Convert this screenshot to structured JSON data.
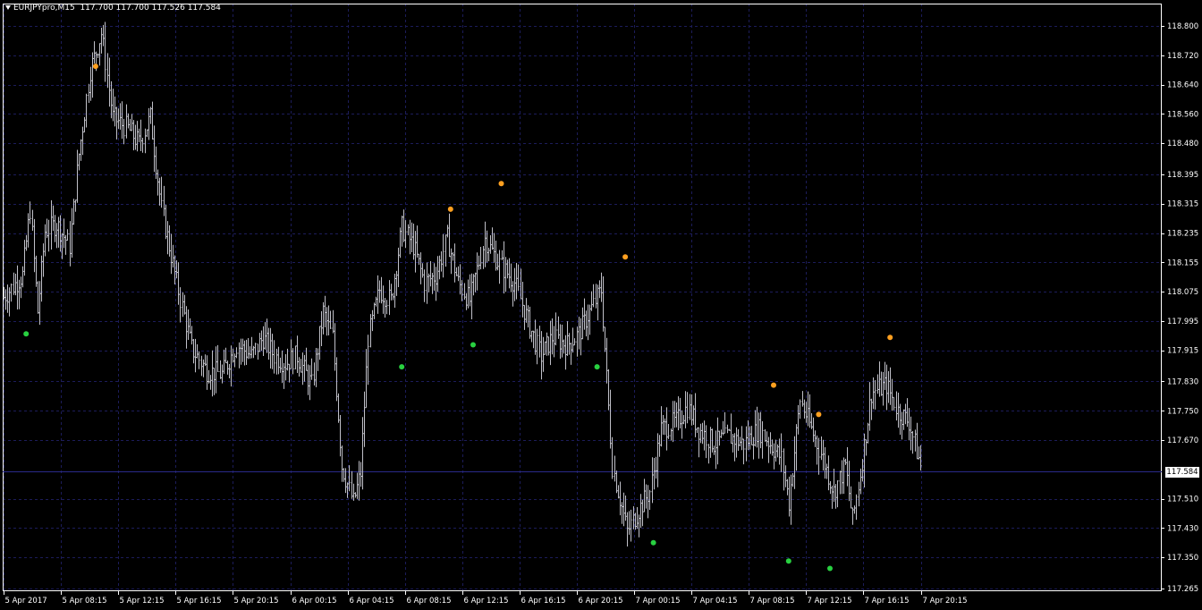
{
  "header": {
    "symbol_timeframe": "EURJPYpro,M15",
    "ohlc": "117.700 117.700 117.526 117.584"
  },
  "current_price": "117.584",
  "colors": {
    "background": "#000000",
    "grid": "#1c1c5a",
    "bars": "#c0c0c8",
    "axis": "#ffffff",
    "resistance_dot": "#ffa020",
    "support_dot": "#28d040",
    "bid_line": "#2a2a8a"
  },
  "chart_data": {
    "type": "ohlc",
    "symbol": "EURJPYpro",
    "timeframe": "M15",
    "ylim": [
      117.26,
      118.86
    ],
    "y_ticks": [
      "118.800",
      "118.720",
      "118.640",
      "118.560",
      "118.480",
      "118.395",
      "118.315",
      "118.235",
      "118.155",
      "118.075",
      "117.995",
      "117.915",
      "117.830",
      "117.750",
      "117.670",
      "117.584",
      "117.510",
      "117.430",
      "117.350",
      "117.265"
    ],
    "x_ticks": [
      "5 Apr 2017",
      "5 Apr 08:15",
      "5 Apr 12:15",
      "5 Apr 16:15",
      "5 Apr 20:15",
      "6 Apr 00:15",
      "6 Apr 04:15",
      "6 Apr 08:15",
      "6 Apr 12:15",
      "6 Apr 16:15",
      "6 Apr 20:15",
      "7 Apr 00:15",
      "7 Apr 04:15",
      "7 Apr 08:15",
      "7 Apr 12:15",
      "7 Apr 16:15",
      "7 Apr 20:15"
    ],
    "bar_count": 258,
    "anchors": [
      [
        0,
        118.06
      ],
      [
        10,
        118.12
      ],
      [
        14,
        118.3
      ],
      [
        18,
        118.02
      ],
      [
        22,
        118.24
      ],
      [
        28,
        118.26
      ],
      [
        35,
        118.2
      ],
      [
        40,
        118.45
      ],
      [
        46,
        118.68
      ],
      [
        52,
        118.78
      ],
      [
        58,
        118.55
      ],
      [
        66,
        118.52
      ],
      [
        72,
        118.48
      ],
      [
        78,
        118.55
      ],
      [
        84,
        118.3
      ],
      [
        92,
        118.1
      ],
      [
        100,
        117.92
      ],
      [
        108,
        117.86
      ],
      [
        116,
        117.85
      ],
      [
        124,
        117.93
      ],
      [
        132,
        117.9
      ],
      [
        138,
        117.95
      ],
      [
        144,
        117.9
      ],
      [
        150,
        117.88
      ],
      [
        156,
        117.9
      ],
      [
        164,
        117.82
      ],
      [
        170,
        118.02
      ],
      [
        175,
        117.95
      ],
      [
        180,
        117.6
      ],
      [
        186,
        117.5
      ],
      [
        190,
        117.58
      ],
      [
        194,
        117.95
      ],
      [
        200,
        118.08
      ],
      [
        206,
        118.05
      ],
      [
        212,
        118.25
      ],
      [
        218,
        118.2
      ],
      [
        224,
        118.1
      ],
      [
        230,
        118.12
      ],
      [
        236,
        118.22
      ],
      [
        242,
        118.1
      ],
      [
        248,
        118.05
      ],
      [
        256,
        118.22
      ],
      [
        264,
        118.15
      ],
      [
        272,
        118.1
      ],
      [
        280,
        117.98
      ],
      [
        286,
        117.9
      ],
      [
        292,
        117.95
      ],
      [
        300,
        117.93
      ],
      [
        306,
        117.96
      ],
      [
        312,
        118.02
      ],
      [
        318,
        118.08
      ],
      [
        324,
        117.6
      ],
      [
        332,
        117.42
      ],
      [
        338,
        117.48
      ],
      [
        344,
        117.53
      ],
      [
        350,
        117.7
      ],
      [
        358,
        117.72
      ],
      [
        364,
        117.76
      ],
      [
        370,
        117.7
      ],
      [
        378,
        117.66
      ],
      [
        386,
        117.68
      ],
      [
        394,
        117.66
      ],
      [
        402,
        117.7
      ],
      [
        408,
        117.66
      ],
      [
        414,
        117.62
      ],
      [
        418,
        117.5
      ],
      [
        424,
        117.78
      ],
      [
        430,
        117.7
      ],
      [
        436,
        117.62
      ],
      [
        442,
        117.53
      ],
      [
        448,
        117.6
      ],
      [
        452,
        117.45
      ],
      [
        456,
        117.58
      ],
      [
        462,
        117.8
      ],
      [
        470,
        117.82
      ],
      [
        476,
        117.75
      ],
      [
        482,
        117.72
      ],
      [
        488,
        117.6
      ]
    ],
    "last_bar_index": 488,
    "resistance_dots": [
      {
        "bar": 49,
        "price": 118.69
      },
      {
        "bar": 238,
        "price": 118.3
      },
      {
        "bar": 265,
        "price": 118.37
      },
      {
        "bar": 331,
        "price": 118.17
      },
      {
        "bar": 410,
        "price": 117.82
      },
      {
        "bar": 434,
        "price": 117.74
      },
      {
        "bar": 472,
        "price": 117.95
      }
    ],
    "support_dots": [
      {
        "bar": 12,
        "price": 117.96
      },
      {
        "bar": 212,
        "price": 117.87
      },
      {
        "bar": 250,
        "price": 117.93
      },
      {
        "bar": 316,
        "price": 117.87
      },
      {
        "bar": 346,
        "price": 117.39
      },
      {
        "bar": 418,
        "price": 117.34
      },
      {
        "bar": 440,
        "price": 117.32
      }
    ]
  }
}
